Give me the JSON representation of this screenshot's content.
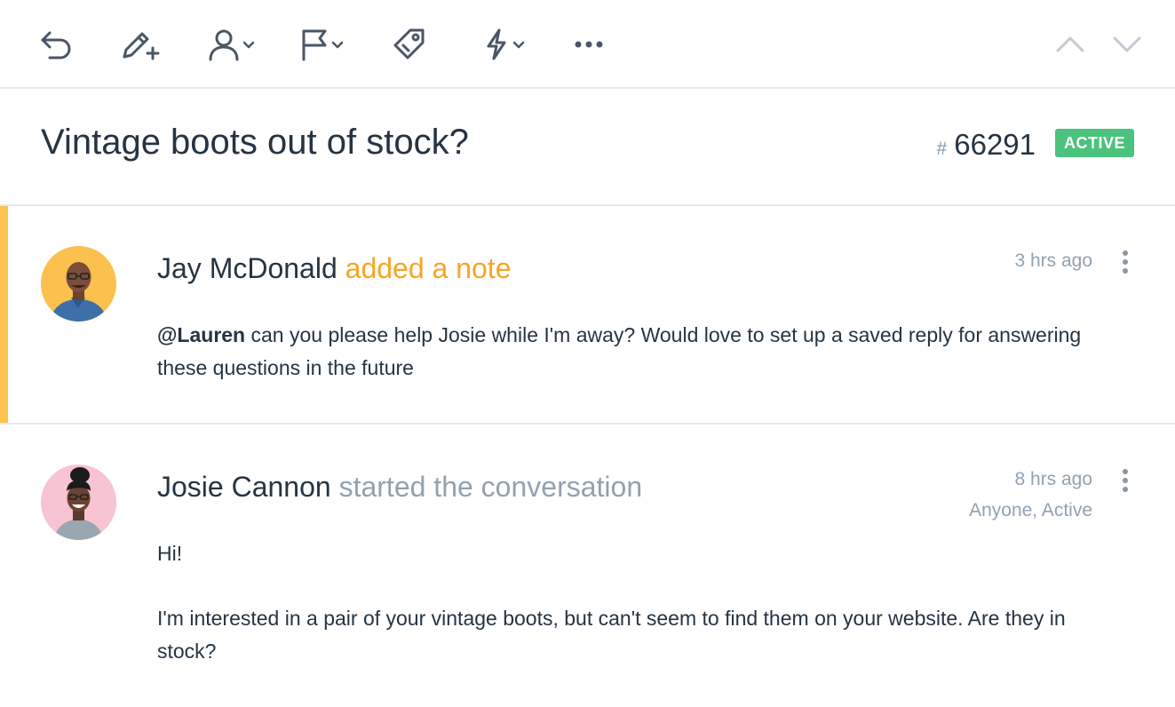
{
  "toolbar": {
    "icons": [
      "reply-icon",
      "add-note-icon",
      "assign-user-icon",
      "flag-icon",
      "tag-icon",
      "workflow-bolt-icon",
      "more-icon",
      "prev-arrow-icon",
      "next-arrow-icon"
    ]
  },
  "conversation": {
    "title": "Vintage boots out of stock?",
    "hash": "#",
    "number": "66291",
    "status": "ACTIVE",
    "status_color": "#4bc27d"
  },
  "thread": [
    {
      "author": "Jay McDonald",
      "action": "added a note",
      "time": "3 hrs ago",
      "mention": "@Lauren",
      "body": " can you please help Josie while I'm away? Would love to set up a saved reply for answering these questions in the future",
      "accent_color": "#ffc44d"
    },
    {
      "author": "Josie Cannon",
      "action": "started the conversation",
      "time": "8 hrs ago",
      "meta": "Anyone, Active",
      "body_lines": [
        "Hi!",
        "I'm interested in a pair of your vintage boots, but can't seem to find them on your website. Are they in stock?"
      ]
    }
  ]
}
